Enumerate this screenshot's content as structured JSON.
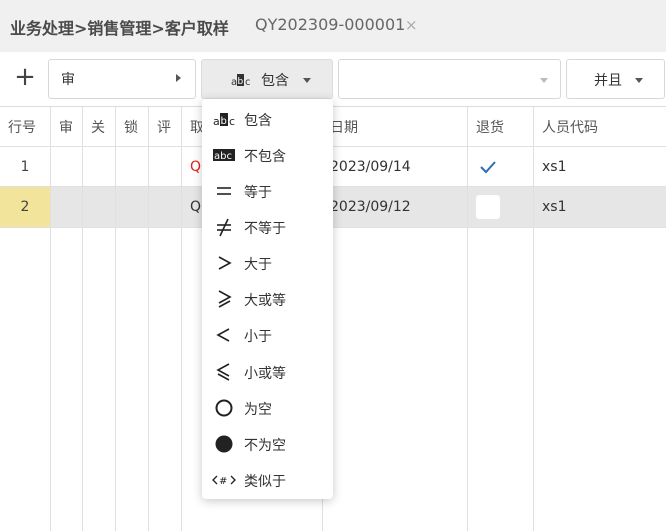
{
  "header": {
    "breadcrumb": "业务处理>销售管理>客户取样",
    "doc_tab": "QY202309-000001",
    "close_symbol": "×"
  },
  "toolbar": {
    "add_symbol": "+",
    "field_value": "审",
    "operator_value": "包含",
    "value_text": "",
    "logic_value": "并且"
  },
  "grid": {
    "columns": [
      "行号",
      "审",
      "关",
      "锁",
      "评",
      "取",
      "日期",
      "退货",
      "人员代码"
    ],
    "rows": [
      {
        "no": "1",
        "code": "Q",
        "date": "2023/09/14",
        "returned": true,
        "staff": "xs1",
        "selected": false
      },
      {
        "no": "2",
        "code": "Q",
        "date": "2023/09/12",
        "returned": false,
        "staff": "xs1",
        "selected": true
      }
    ]
  },
  "operator_menu": {
    "items": [
      {
        "icon": "abc-contains-icon",
        "label": "包含"
      },
      {
        "icon": "abc-not-contains-icon",
        "label": "不包含"
      },
      {
        "icon": "equals-icon",
        "label": "等于"
      },
      {
        "icon": "not-equals-icon",
        "label": "不等于"
      },
      {
        "icon": "greater-than-icon",
        "label": "大于"
      },
      {
        "icon": "greater-or-equal-icon",
        "label": "大或等"
      },
      {
        "icon": "less-than-icon",
        "label": "小于"
      },
      {
        "icon": "less-or-equal-icon",
        "label": "小或等"
      },
      {
        "icon": "empty-circle-icon",
        "label": "为空"
      },
      {
        "icon": "filled-circle-icon",
        "label": "不为空"
      },
      {
        "icon": "like-pattern-icon",
        "label": "类似于"
      }
    ]
  },
  "colors": {
    "header_bg": "#f0f0f0",
    "selected_row_bg": "#e6e6e6",
    "current_row_marker": "#f2e49a",
    "red_text": "#e02020",
    "check_blue": "#2f6db5"
  }
}
